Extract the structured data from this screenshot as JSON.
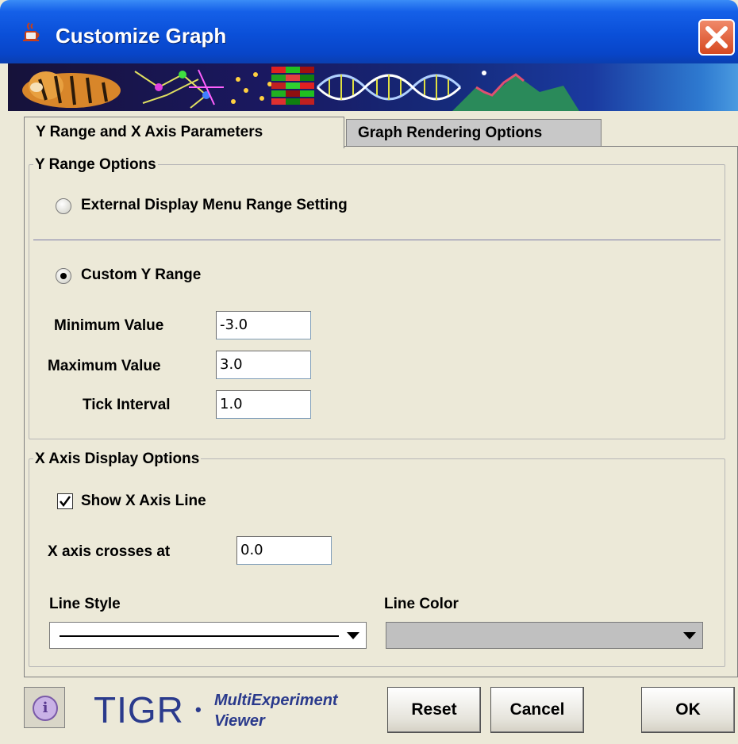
{
  "window": {
    "title": "Customize Graph",
    "close_icon": "close-icon",
    "app_icon": "java-coffee-icon"
  },
  "banner": {
    "icon": "tigr-banner-image"
  },
  "tabs": [
    {
      "label": "Y Range and X Axis Parameters",
      "active": true
    },
    {
      "label": "Graph Rendering Options",
      "active": false
    }
  ],
  "y_range": {
    "legend": "Y Range Options",
    "option_external": {
      "label": "External Display Menu Range Setting",
      "selected": false
    },
    "option_custom": {
      "label": "Custom Y Range",
      "selected": true
    },
    "min_label": "Minimum Value",
    "min_value": "-3.0",
    "max_label": "Maximum Value",
    "max_value": "3.0",
    "tick_label": "Tick Interval",
    "tick_value": "1.0"
  },
  "x_axis": {
    "legend": "X Axis Display Options",
    "show_line_label": "Show X Axis Line",
    "show_line_checked": true,
    "crosses_label": "X axis crosses at",
    "crosses_value": "0.0",
    "line_style_label": "Line Style",
    "line_color_label": "Line Color",
    "line_color_value": "#c0c0c0"
  },
  "footer": {
    "logo_text": "TIGR",
    "logo_bullet": "•",
    "logo_sub1": "MultiExperiment",
    "logo_sub2": "Viewer",
    "info_icon": "info-icon",
    "reset_label": "Reset",
    "cancel_label": "Cancel",
    "ok_label": "OK"
  },
  "colors": {
    "titlebar": "#0a4fd8",
    "dialog_bg": "#ece9d8",
    "logo_blue": "#2a3a8c"
  }
}
